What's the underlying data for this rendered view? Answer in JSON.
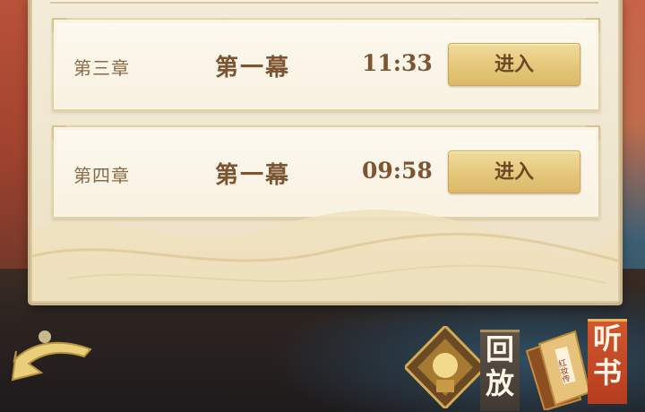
{
  "chapters": [
    {
      "chapter": "第三章",
      "act": "第一幕",
      "time": "11:33",
      "button": "进入"
    },
    {
      "chapter": "第四章",
      "act": "第一幕",
      "time": "09:58",
      "button": "进入"
    }
  ],
  "bottom_bar": {
    "replay_label": "回放",
    "listen_label": "听书",
    "book_spine_text": "红妆传"
  },
  "icons": {
    "back": "back-arrow-icon",
    "replay": "replay-lantern-icon",
    "listen": "book-stack-icon"
  },
  "colors": {
    "panel": "#f3ecda",
    "button": "#e6c97d",
    "text_brown": "#7d5532",
    "listen_tab": "#c64a26"
  }
}
